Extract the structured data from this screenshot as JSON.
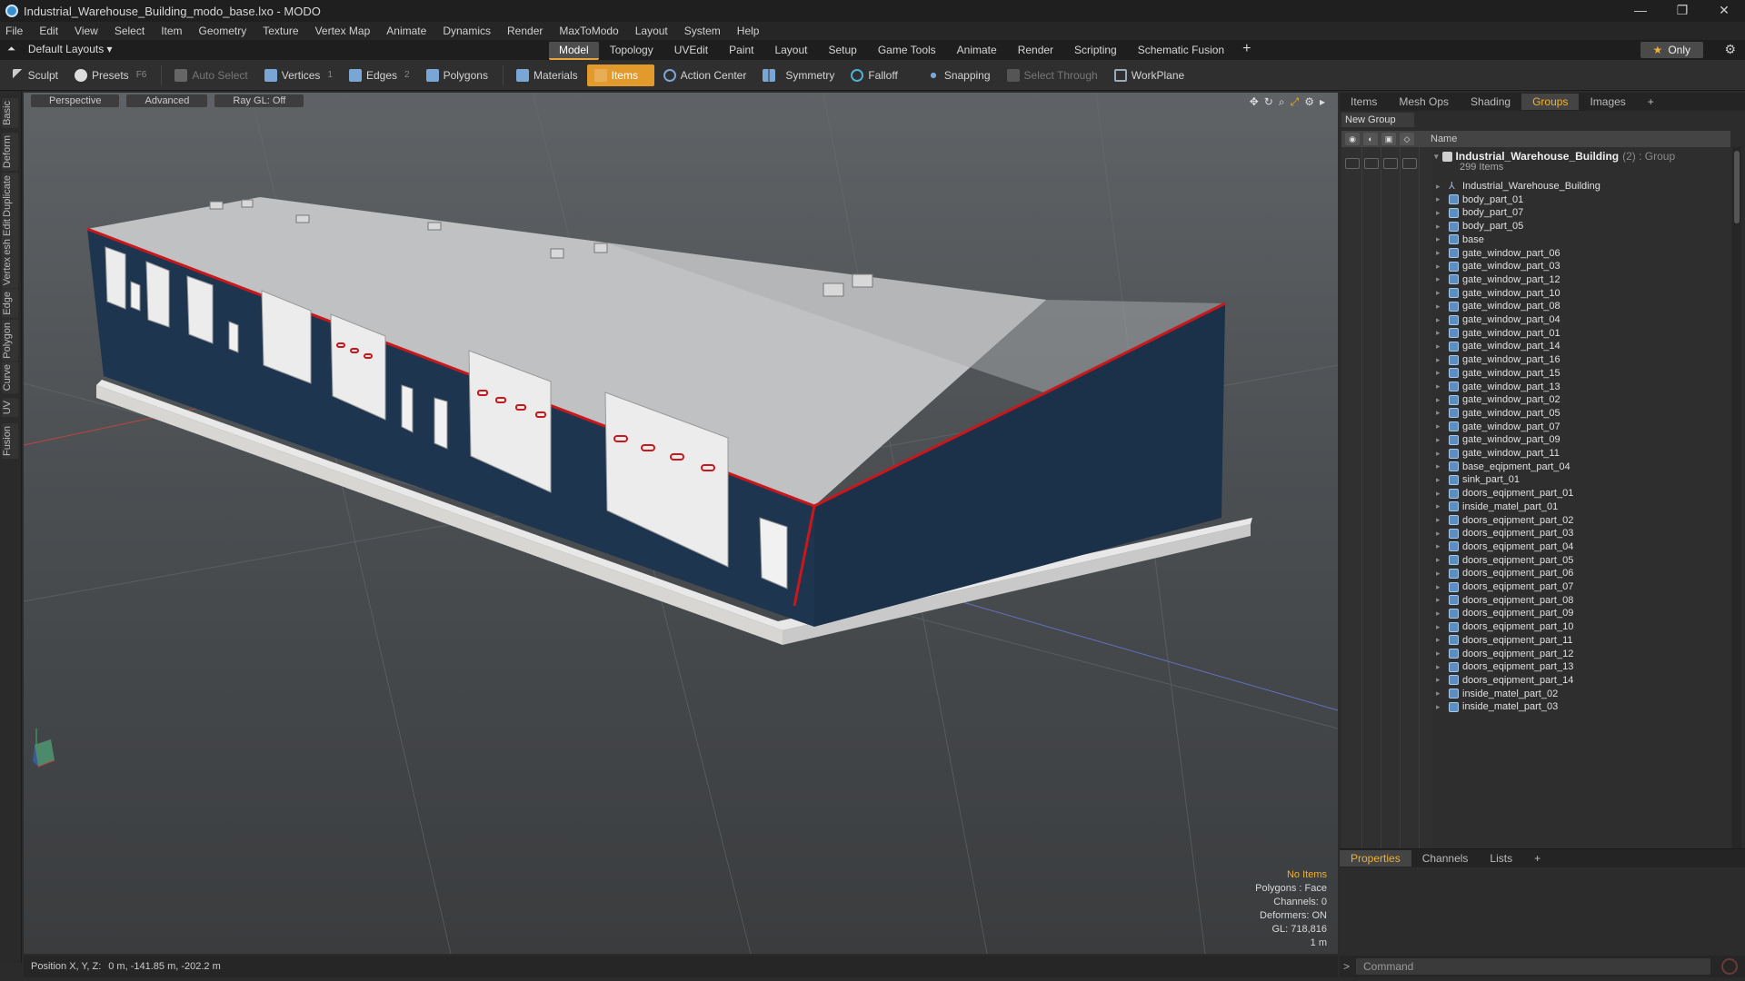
{
  "window": {
    "title": "Industrial_Warehouse_Building_modo_base.lxo - MODO",
    "minimize": "—",
    "maximize": "❐",
    "close": "✕"
  },
  "menu": [
    "File",
    "Edit",
    "View",
    "Select",
    "Item",
    "Geometry",
    "Texture",
    "Vertex Map",
    "Animate",
    "Dynamics",
    "Render",
    "MaxToModo",
    "Layout",
    "System",
    "Help"
  ],
  "layouts": {
    "label": "Default Layouts ▾"
  },
  "mode_tabs": [
    {
      "label": "Model",
      "active": true
    },
    {
      "label": "Topology"
    },
    {
      "label": "UVEdit"
    },
    {
      "label": "Paint"
    },
    {
      "label": "Layout"
    },
    {
      "label": "Setup"
    },
    {
      "label": "Game Tools"
    },
    {
      "label": "Animate"
    },
    {
      "label": "Render"
    },
    {
      "label": "Scripting"
    },
    {
      "label": "Schematic Fusion"
    }
  ],
  "only_button": "Only",
  "toolbar": {
    "sculpt": "Sculpt",
    "presets": "Presets",
    "presets_key": "F6",
    "auto_select": "Auto Select",
    "vertices": "Vertices",
    "vertices_key": "1",
    "edges": "Edges",
    "edges_key": "2",
    "polygons": "Polygons",
    "materials": "Materials",
    "items": "Items",
    "action_center": "Action Center",
    "symmetry": "Symmetry",
    "falloff": "Falloff",
    "snapping": "Snapping",
    "select_through": "Select Through",
    "workplane": "WorkPlane"
  },
  "left_tabs": [
    "Basic",
    "Deform",
    "Duplicate",
    "Mesh Edit",
    "Vertex",
    "Edge",
    "Polygon",
    "Curve",
    "UV",
    "Fusion"
  ],
  "viewport": {
    "view": "Perspective",
    "shading": "Advanced",
    "raygl": "Ray GL: Off",
    "info": {
      "items": "No Items",
      "polygons": "Polygons : Face",
      "channels": "Channels: 0",
      "deformers": "Deformers: ON",
      "gl": "GL: 718,816",
      "scale": "1 m"
    }
  },
  "status": {
    "position_label": "Position X, Y, Z:",
    "position_value": "0 m, -141.85 m, -202.2 m"
  },
  "right_panel": {
    "tabs": [
      {
        "label": "Items"
      },
      {
        "label": "Mesh Ops"
      },
      {
        "label": "Shading"
      },
      {
        "label": "Groups",
        "active": true
      },
      {
        "label": "Images"
      }
    ],
    "new_group": "New Group",
    "col_name": "Name",
    "group": {
      "name": "Industrial_Warehouse_Building",
      "count": "(2) : Group",
      "sub": "299 Items"
    },
    "items": [
      {
        "name": "Industrial_Warehouse_Building",
        "type": "locator"
      },
      {
        "name": "body_part_01"
      },
      {
        "name": "body_part_07"
      },
      {
        "name": "body_part_05"
      },
      {
        "name": "base"
      },
      {
        "name": "gate_window_part_06"
      },
      {
        "name": "gate_window_part_03"
      },
      {
        "name": "gate_window_part_12"
      },
      {
        "name": "gate_window_part_10"
      },
      {
        "name": "gate_window_part_08"
      },
      {
        "name": "gate_window_part_04"
      },
      {
        "name": "gate_window_part_01"
      },
      {
        "name": "gate_window_part_14"
      },
      {
        "name": "gate_window_part_16"
      },
      {
        "name": "gate_window_part_15"
      },
      {
        "name": "gate_window_part_13"
      },
      {
        "name": "gate_window_part_02"
      },
      {
        "name": "gate_window_part_05"
      },
      {
        "name": "gate_window_part_07"
      },
      {
        "name": "gate_window_part_09"
      },
      {
        "name": "gate_window_part_11"
      },
      {
        "name": "base_eqipment_part_04"
      },
      {
        "name": "sink_part_01"
      },
      {
        "name": "doors_eqipment_part_01"
      },
      {
        "name": "inside_matel_part_01"
      },
      {
        "name": "doors_eqipment_part_02"
      },
      {
        "name": "doors_eqipment_part_03"
      },
      {
        "name": "doors_eqipment_part_04"
      },
      {
        "name": "doors_eqipment_part_05"
      },
      {
        "name": "doors_eqipment_part_06"
      },
      {
        "name": "doors_eqipment_part_07"
      },
      {
        "name": "doors_eqipment_part_08"
      },
      {
        "name": "doors_eqipment_part_09"
      },
      {
        "name": "doors_eqipment_part_10"
      },
      {
        "name": "doors_eqipment_part_11"
      },
      {
        "name": "doors_eqipment_part_12"
      },
      {
        "name": "doors_eqipment_part_13"
      },
      {
        "name": "doors_eqipment_part_14"
      },
      {
        "name": "inside_matel_part_02"
      },
      {
        "name": "inside_matel_part_03"
      }
    ]
  },
  "props_panel": {
    "tabs": [
      {
        "label": "Properties",
        "active": true
      },
      {
        "label": "Channels"
      },
      {
        "label": "Lists"
      }
    ]
  },
  "command": {
    "placeholder": "Command",
    "prompt": ">"
  },
  "colors": {
    "accent": "#e39a2c",
    "highlight": "#f0b030",
    "wall": "#1e3550",
    "trim": "#c8181c"
  }
}
